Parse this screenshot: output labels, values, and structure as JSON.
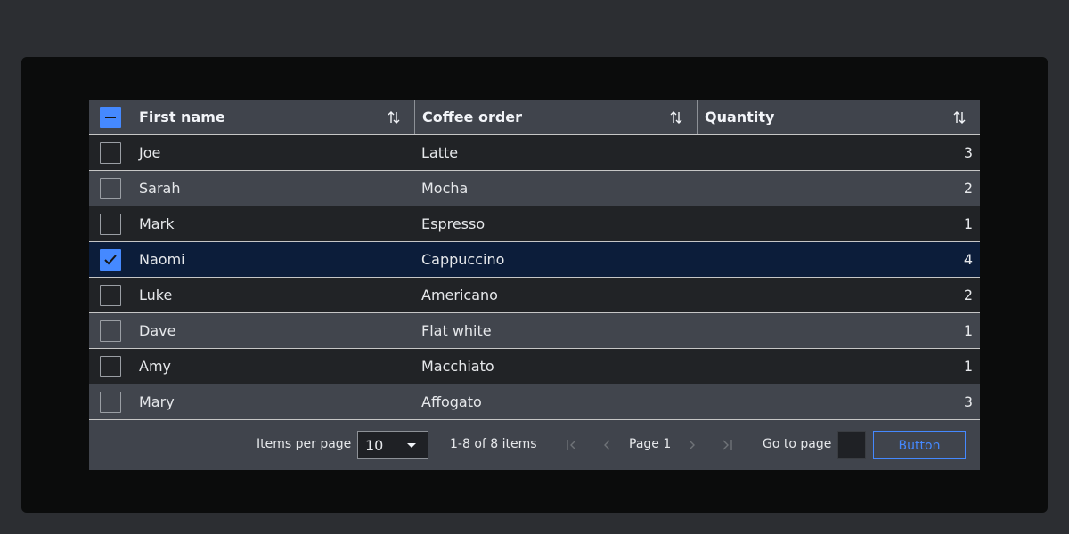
{
  "table": {
    "columns": [
      {
        "label": "First name"
      },
      {
        "label": "Coffee order"
      },
      {
        "label": "Quantity"
      }
    ],
    "rows": [
      {
        "first_name": "Joe",
        "coffee": "Latte",
        "quantity": "3",
        "checked": false
      },
      {
        "first_name": "Sarah",
        "coffee": "Mocha",
        "quantity": "2",
        "checked": false
      },
      {
        "first_name": "Mark",
        "coffee": "Espresso",
        "quantity": "1",
        "checked": false
      },
      {
        "first_name": "Naomi",
        "coffee": "Cappuccino",
        "quantity": "4",
        "checked": true
      },
      {
        "first_name": "Luke",
        "coffee": "Americano",
        "quantity": "2",
        "checked": false
      },
      {
        "first_name": "Dave",
        "coffee": "Flat white",
        "quantity": "1",
        "checked": false
      },
      {
        "first_name": "Amy",
        "coffee": "Macchiato",
        "quantity": "1",
        "checked": false
      },
      {
        "first_name": "Mary",
        "coffee": "Affogato",
        "quantity": "3",
        "checked": false
      }
    ],
    "select_all_state": "indeterminate"
  },
  "pagination": {
    "items_per_page_label": "Items per page",
    "items_per_page_value": "10",
    "range_text": "1-8 of 8 items",
    "page_label": "Page 1",
    "goto_label": "Go to page",
    "goto_value": "",
    "button_label": "Button"
  },
  "colors": {
    "accent": "#4589ff",
    "selected_row": "#0c1d3a"
  }
}
